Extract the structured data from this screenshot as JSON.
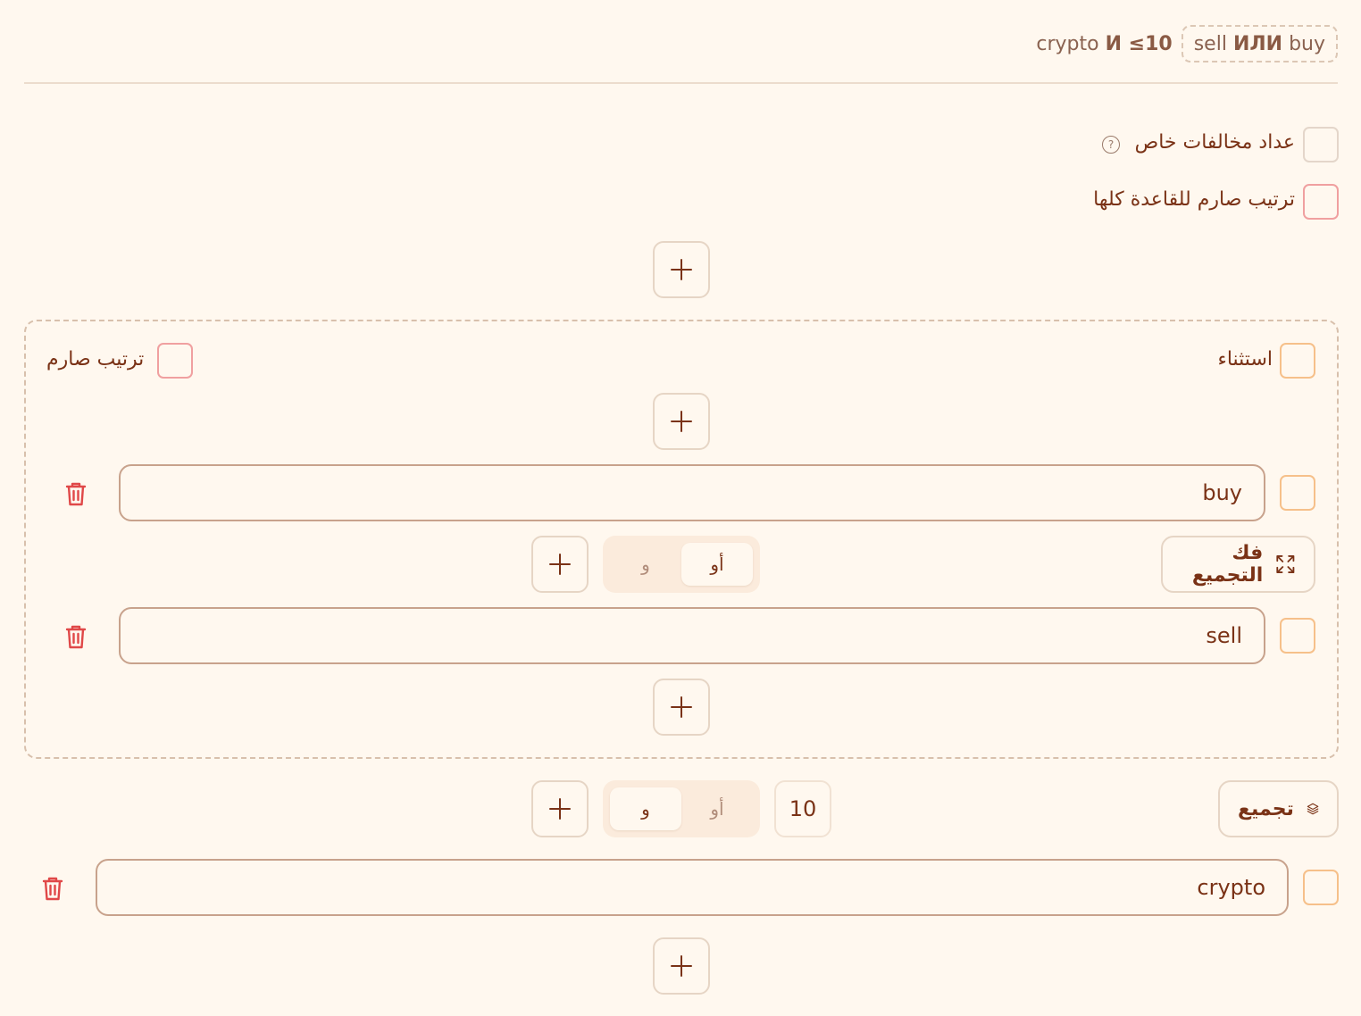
{
  "summary": {
    "left_text": "crypto",
    "left_op": "И ≤10",
    "chip_a": "sell",
    "chip_op": "ИЛИ",
    "chip_b": "buy"
  },
  "options": {
    "custom_violation_counter": "عداد مخالفات خاص",
    "help_glyph": "?",
    "strict_order_whole_rule": "ترتيب صارم للقاعدة كلها"
  },
  "group": {
    "exception_label": "استثناء",
    "strict_order_label": "ترتيب صارم",
    "items": [
      {
        "value": "buy"
      },
      {
        "value": "sell"
      }
    ],
    "ungroup_label": "فك التجميع",
    "operator": {
      "or": "أو",
      "and": "و",
      "selected": "أو"
    }
  },
  "root": {
    "group_label": "تجميع",
    "operator": {
      "or": "أو",
      "and": "و",
      "selected": "و"
    },
    "count": "10",
    "items": [
      {
        "value": "crypto"
      }
    ]
  },
  "colors": {
    "background": "#fff8ef",
    "text": "#7a3216",
    "danger": "#e04848",
    "checkbox_red": "#f0a0a0",
    "checkbox_orange": "#f6c08a"
  },
  "icons": {
    "add": "plus-icon",
    "delete": "trash-icon",
    "ungroup": "expand-arrows-icon",
    "group": "layers-icon",
    "help": "question-circle-icon"
  }
}
